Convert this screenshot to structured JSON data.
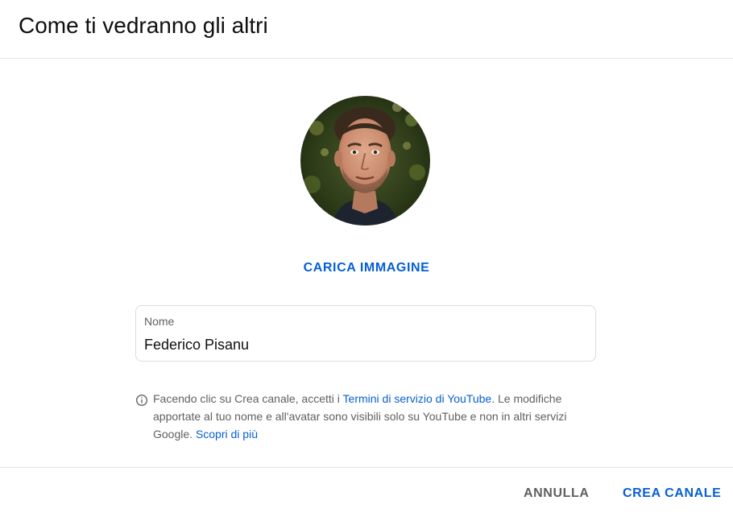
{
  "dialog": {
    "title": "Come ti vedranno gli altri"
  },
  "avatar": {
    "icon": "profile-photo"
  },
  "upload_button": "CARICA IMMAGINE",
  "name_field": {
    "label": "Nome",
    "value": "Federico Pisanu"
  },
  "notice": {
    "icon": "info-icon",
    "text_before": "Facendo clic su Crea canale, accetti i ",
    "terms_link": "Termini di servizio di YouTube",
    "text_after": ". Le modifiche apportate al tuo nome e all'avatar sono visibili solo su YouTube e non in altri servizi Google. ",
    "learn_more_link": "Scopri di più"
  },
  "footer": {
    "cancel_label": "ANNULLA",
    "create_label": "CREA CANALE"
  },
  "colors": {
    "accent": "#065fd4",
    "secondary_text": "#606060",
    "divider": "#e5e5e5"
  }
}
